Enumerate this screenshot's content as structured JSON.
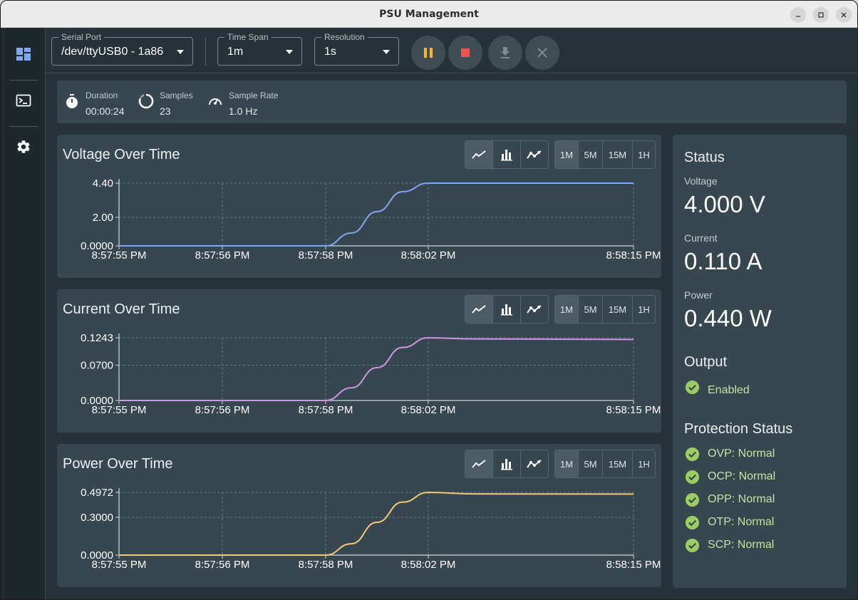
{
  "window": {
    "title": "PSU Management",
    "min_icon": "minimize-icon",
    "max_icon": "maximize-icon",
    "close_icon": "close-icon"
  },
  "sidebar": {
    "items": [
      {
        "name": "dashboard-icon",
        "active": true
      },
      {
        "name": "terminal-icon",
        "active": false
      },
      {
        "name": "settings-icon",
        "active": false
      }
    ]
  },
  "toolbar": {
    "serial_port": {
      "label": "Serial Port",
      "value": "/dev/ttyUSB0 - 1a86"
    },
    "time_span": {
      "label": "Time Span",
      "value": "1m"
    },
    "resolution": {
      "label": "Resolution",
      "value": "1s"
    },
    "buttons": [
      "pause-icon",
      "stop-icon",
      "download-icon",
      "clear-icon"
    ]
  },
  "stats": {
    "duration": {
      "label": "Duration",
      "value": "00:00:24"
    },
    "samples": {
      "label": "Samples",
      "value": "23"
    },
    "sample_rate": {
      "label": "Sample Rate",
      "value": "1.0 Hz"
    }
  },
  "chart_controls": {
    "types": [
      "line-chart-icon",
      "bar-chart-icon",
      "scatter-line-icon"
    ],
    "ranges": [
      "1M",
      "5M",
      "15M",
      "1H"
    ],
    "active_range": "1M"
  },
  "colors": {
    "voltage": "#82a7f2",
    "current": "#cf93e8",
    "power": "#f4c77a",
    "accent_ok": "#9ccc65",
    "ok_text": "#c5e1a5"
  },
  "chart_data": [
    {
      "type": "line",
      "title": "Voltage Over Time",
      "x_ticks": [
        "8:57:55 PM",
        "8:57:56 PM",
        "8:57:58 PM",
        "8:58:02 PM",
        "8:58:15 PM"
      ],
      "y_ticks": [
        "4.40",
        "2.00",
        "0.0000"
      ],
      "ylim": [
        0,
        4.4
      ],
      "x": [
        "8:57:55 PM",
        "8:57:56 PM",
        "8:57:57 PM",
        "8:57:58 PM",
        "8:57:59 PM",
        "8:58:00 PM",
        "8:58:01 PM",
        "8:58:02 PM",
        "8:58:15 PM"
      ],
      "series": [
        {
          "values": [
            0,
            0,
            0,
            0,
            0.9,
            2.4,
            3.8,
            4.4,
            4.4
          ]
        }
      ],
      "grid": true
    },
    {
      "type": "line",
      "title": "Current Over Time",
      "x_ticks": [
        "8:57:55 PM",
        "8:57:56 PM",
        "8:57:58 PM",
        "8:58:02 PM",
        "8:58:15 PM"
      ],
      "y_ticks": [
        "0.1243",
        "0.0700",
        "0.0000"
      ],
      "ylim": [
        0,
        0.1243
      ],
      "x": [
        "8:57:55 PM",
        "8:57:56 PM",
        "8:57:57 PM",
        "8:57:58 PM",
        "8:57:59 PM",
        "8:58:00 PM",
        "8:58:01 PM",
        "8:58:02 PM",
        "8:58:05 PM",
        "8:58:15 PM"
      ],
      "series": [
        {
          "values": [
            0,
            0,
            0,
            0,
            0.025,
            0.065,
            0.105,
            0.1243,
            0.122,
            0.121
          ]
        }
      ],
      "grid": true
    },
    {
      "type": "line",
      "title": "Power Over Time",
      "x_ticks": [
        "8:57:55 PM",
        "8:57:56 PM",
        "8:57:58 PM",
        "8:58:02 PM",
        "8:58:15 PM"
      ],
      "y_ticks": [
        "0.4972",
        "0.3000",
        "0.0000"
      ],
      "ylim": [
        0,
        0.4972
      ],
      "x": [
        "8:57:55 PM",
        "8:57:56 PM",
        "8:57:57 PM",
        "8:57:58 PM",
        "8:57:59 PM",
        "8:58:00 PM",
        "8:58:01 PM",
        "8:58:02 PM",
        "8:58:05 PM",
        "8:58:15 PM"
      ],
      "series": [
        {
          "values": [
            0,
            0,
            0,
            0,
            0.09,
            0.26,
            0.42,
            0.4972,
            0.485,
            0.484
          ]
        }
      ],
      "grid": true
    }
  ],
  "status": {
    "title": "Status",
    "voltage": {
      "label": "Voltage",
      "value": "4.000 V"
    },
    "current": {
      "label": "Current",
      "value": "0.110 A"
    },
    "power": {
      "label": "Power",
      "value": "0.440 W"
    },
    "output": {
      "title": "Output",
      "value": "Enabled"
    },
    "protection": {
      "title": "Protection Status",
      "items": [
        "OVP: Normal",
        "OCP: Normal",
        "OPP: Normal",
        "OTP: Normal",
        "SCP: Normal"
      ]
    }
  }
}
